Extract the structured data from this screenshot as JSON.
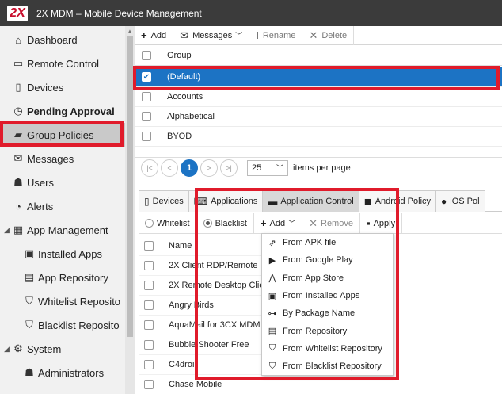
{
  "app": {
    "logo": "2X",
    "title": "2X MDM – Mobile Device Management"
  },
  "sidebar": {
    "items": [
      {
        "label": "Dashboard",
        "icon": "home-icon"
      },
      {
        "label": "Remote Control",
        "icon": "monitor-icon"
      },
      {
        "label": "Devices",
        "icon": "phone-icon"
      },
      {
        "label": "Pending Approval",
        "icon": "clock-icon"
      },
      {
        "label": "Group Policies",
        "icon": "folder-icon"
      },
      {
        "label": "Messages",
        "icon": "envelope-icon"
      },
      {
        "label": "Users",
        "icon": "users-icon"
      },
      {
        "label": "Alerts",
        "icon": "timer-icon"
      },
      {
        "label": "App Management",
        "icon": "apps-icon"
      },
      {
        "label": "Installed Apps",
        "icon": "installed-icon"
      },
      {
        "label": "App Repository",
        "icon": "repository-icon"
      },
      {
        "label": "Whitelist Reposito",
        "icon": "shield-icon"
      },
      {
        "label": "Blacklist Reposito",
        "icon": "shield-icon"
      },
      {
        "label": "System",
        "icon": "gears-icon"
      },
      {
        "label": "Administrators",
        "icon": "admin-icon"
      }
    ]
  },
  "toolbar": {
    "add": "Add",
    "messages": "Messages",
    "rename": "Rename",
    "delete": "Delete"
  },
  "groups": {
    "header": "Group",
    "rows": [
      "(Default)",
      "Accounts",
      "Alphabetical",
      "BYOD"
    ]
  },
  "pager": {
    "current_page": "1",
    "page_size": "25",
    "page_size_label": "items per page"
  },
  "tabs": [
    "Devices",
    "Applications",
    "Application Control",
    "Android Policy",
    "iOS Pol"
  ],
  "subbar": {
    "whitelist": "Whitelist",
    "blacklist": "Blacklist",
    "add": "Add",
    "remove": "Remove",
    "apply": "Apply"
  },
  "apps": {
    "header": "Name",
    "rows": [
      "2X Client RDP/Remote D",
      "2X Remote Desktop Clie",
      "Angry Birds",
      "AquaMail for 3CX MDM",
      "Bubble Shooter Free",
      "C4droi",
      "Chase Mobile"
    ]
  },
  "add_menu": {
    "items": [
      {
        "label": "From APK file",
        "icon": "apk-file-icon"
      },
      {
        "label": "From Google Play",
        "icon": "play-icon"
      },
      {
        "label": "From App Store",
        "icon": "app-store-icon"
      },
      {
        "label": "From Installed Apps",
        "icon": "installed-apps-icon"
      },
      {
        "label": "By Package Name",
        "icon": "package-icon"
      },
      {
        "label": "From Repository",
        "icon": "repository-icon"
      },
      {
        "label": "From Whitelist Repository",
        "icon": "whitelist-icon"
      },
      {
        "label": "From Blacklist Repository",
        "icon": "blacklist-icon"
      }
    ]
  },
  "colors": {
    "accent": "#1c73c4",
    "highlight_red": "#e01b2b",
    "titlebar": "#3b3b3b"
  }
}
